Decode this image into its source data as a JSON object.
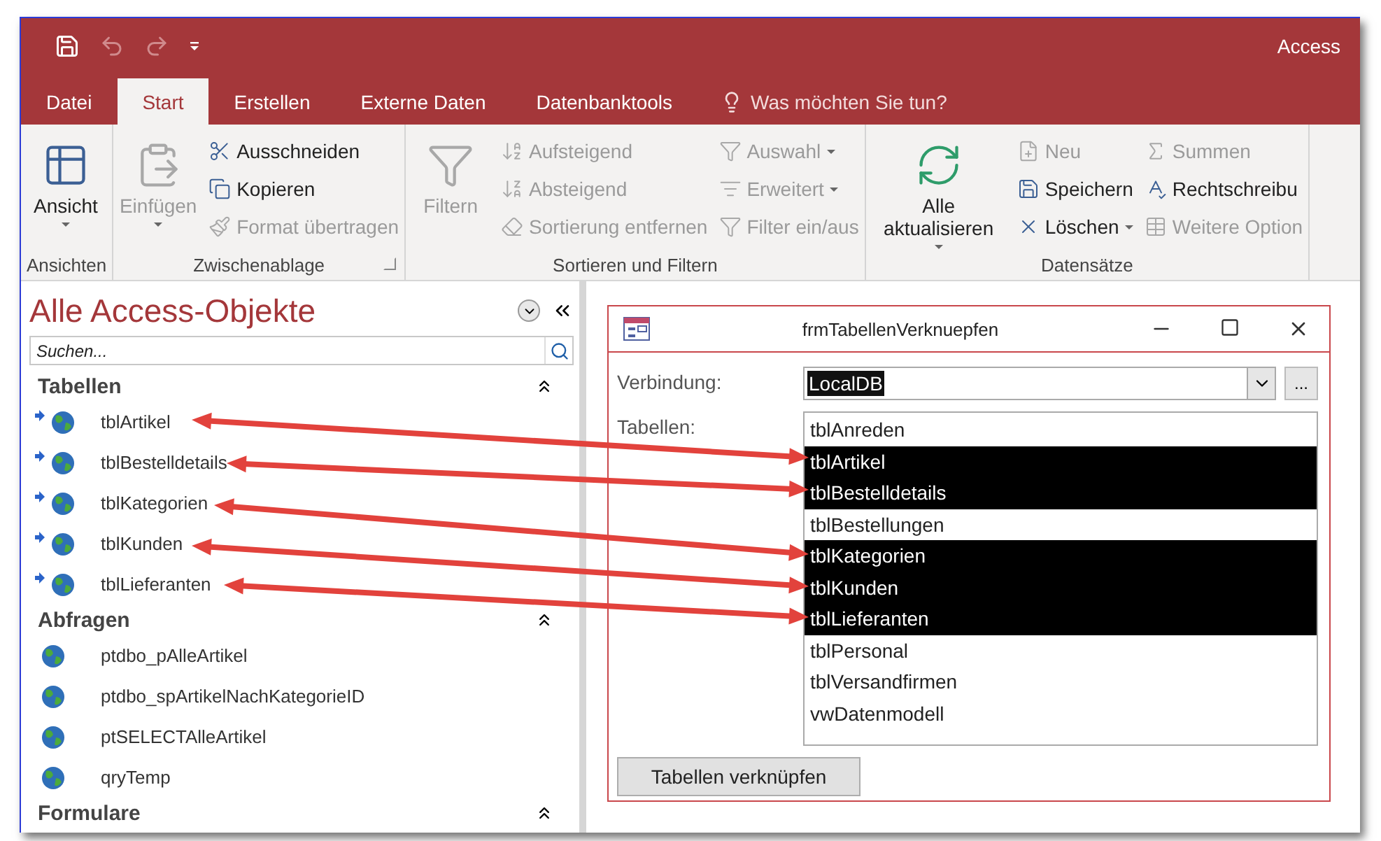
{
  "window": {
    "title": "Access"
  },
  "quick_access": {
    "undo_disabled": true,
    "redo_disabled": true
  },
  "tabs": [
    {
      "label": "Datei",
      "selected": false
    },
    {
      "label": "Start",
      "selected": true
    },
    {
      "label": "Erstellen",
      "selected": false
    },
    {
      "label": "Externe Daten",
      "selected": false
    },
    {
      "label": "Datenbanktools",
      "selected": false
    }
  ],
  "tell_me": {
    "placeholder": "Was möchten Sie tun?"
  },
  "ribbon": {
    "groups": [
      {
        "label": "Ansichten",
        "dialog_launcher": false,
        "columns": [
          [
            {
              "kind": "large",
              "label": "Ansicht",
              "disabled": false,
              "dropdown": true
            }
          ]
        ]
      },
      {
        "label": "Zwischenablage",
        "dialog_launcher": true,
        "columns": [
          [
            {
              "kind": "large",
              "label": "Einfügen",
              "disabled": true,
              "dropdown": true
            }
          ],
          [
            {
              "kind": "small",
              "label": "Ausschneiden",
              "disabled": false,
              "dropdown": false
            },
            {
              "kind": "small",
              "label": "Kopieren",
              "disabled": false,
              "dropdown": false
            },
            {
              "kind": "small",
              "label": "Format übertragen",
              "disabled": true,
              "dropdown": false
            }
          ]
        ]
      },
      {
        "label": "Sortieren und Filtern",
        "dialog_launcher": false,
        "columns": [
          [
            {
              "kind": "large",
              "label": "Filtern",
              "disabled": true,
              "dropdown": false
            }
          ],
          [
            {
              "kind": "small",
              "label": "Aufsteigend",
              "disabled": true,
              "dropdown": false
            },
            {
              "kind": "small",
              "label": "Absteigend",
              "disabled": true,
              "dropdown": false
            },
            {
              "kind": "small",
              "label": "Sortierung entfernen",
              "disabled": true,
              "dropdown": false
            }
          ],
          [
            {
              "kind": "small",
              "label": "Auswahl",
              "disabled": true,
              "dropdown": true
            },
            {
              "kind": "small",
              "label": "Erweitert",
              "disabled": true,
              "dropdown": true
            },
            {
              "kind": "small",
              "label": "Filter ein/aus",
              "disabled": true,
              "dropdown": false
            }
          ]
        ]
      },
      {
        "label": "Datensätze",
        "dialog_launcher": false,
        "columns": [
          [
            {
              "kind": "large",
              "label": "Alle aktualisieren",
              "disabled": false,
              "dropdown": true
            }
          ],
          [
            {
              "kind": "small",
              "label": "Neu",
              "disabled": true,
              "dropdown": false
            },
            {
              "kind": "small",
              "label": "Speichern",
              "disabled": false,
              "dropdown": false
            },
            {
              "kind": "small",
              "label": "Löschen",
              "disabled": false,
              "dropdown": true
            }
          ],
          [
            {
              "kind": "small",
              "label": "Summen",
              "disabled": true,
              "dropdown": false
            },
            {
              "kind": "small",
              "label": "Rechtschreibu",
              "disabled": false,
              "dropdown": false
            },
            {
              "kind": "small",
              "label": "Weitere Option",
              "disabled": true,
              "dropdown": false
            }
          ]
        ]
      }
    ]
  },
  "navigation": {
    "title": "Alle Access-Objekte",
    "search": {
      "placeholder": "Suchen..."
    },
    "sections": [
      {
        "title": "Tabellen",
        "expanded": true,
        "items": [
          {
            "label": "tblArtikel",
            "linked": true
          },
          {
            "label": "tblBestelldetails",
            "linked": true
          },
          {
            "label": "tblKategorien",
            "linked": true
          },
          {
            "label": "tblKunden",
            "linked": true
          },
          {
            "label": "tblLieferanten",
            "linked": true
          }
        ]
      },
      {
        "title": "Abfragen",
        "expanded": true,
        "items": [
          {
            "label": "ptdbo_pAlleArtikel",
            "linked": false
          },
          {
            "label": "ptdbo_spArtikelNachKategorieID",
            "linked": false
          },
          {
            "label": "ptSELECTAlleArtikel",
            "linked": false
          },
          {
            "label": "qryTemp",
            "linked": false
          }
        ]
      },
      {
        "title": "Formulare",
        "expanded": true
      }
    ]
  },
  "form": {
    "title": "frmTabellenVerknuepfen",
    "connection": {
      "label": "Verbindung:",
      "value": "LocalDB",
      "value_highlighted": true,
      "browse_button": "..."
    },
    "tables": {
      "label": "Tabellen:",
      "items": [
        {
          "label": "tblAnreden",
          "selected": false
        },
        {
          "label": "tblArtikel",
          "selected": true
        },
        {
          "label": "tblBestelldetails",
          "selected": true
        },
        {
          "label": "tblBestellungen",
          "selected": false
        },
        {
          "label": "tblKategorien",
          "selected": true
        },
        {
          "label": "tblKunden",
          "selected": true
        },
        {
          "label": "tblLieferanten",
          "selected": true
        },
        {
          "label": "tblPersonal",
          "selected": false
        },
        {
          "label": "tblVersandfirmen",
          "selected": false
        },
        {
          "label": "vwDatenmodell",
          "selected": false
        }
      ]
    },
    "button": "Tabellen verknüpfen"
  }
}
